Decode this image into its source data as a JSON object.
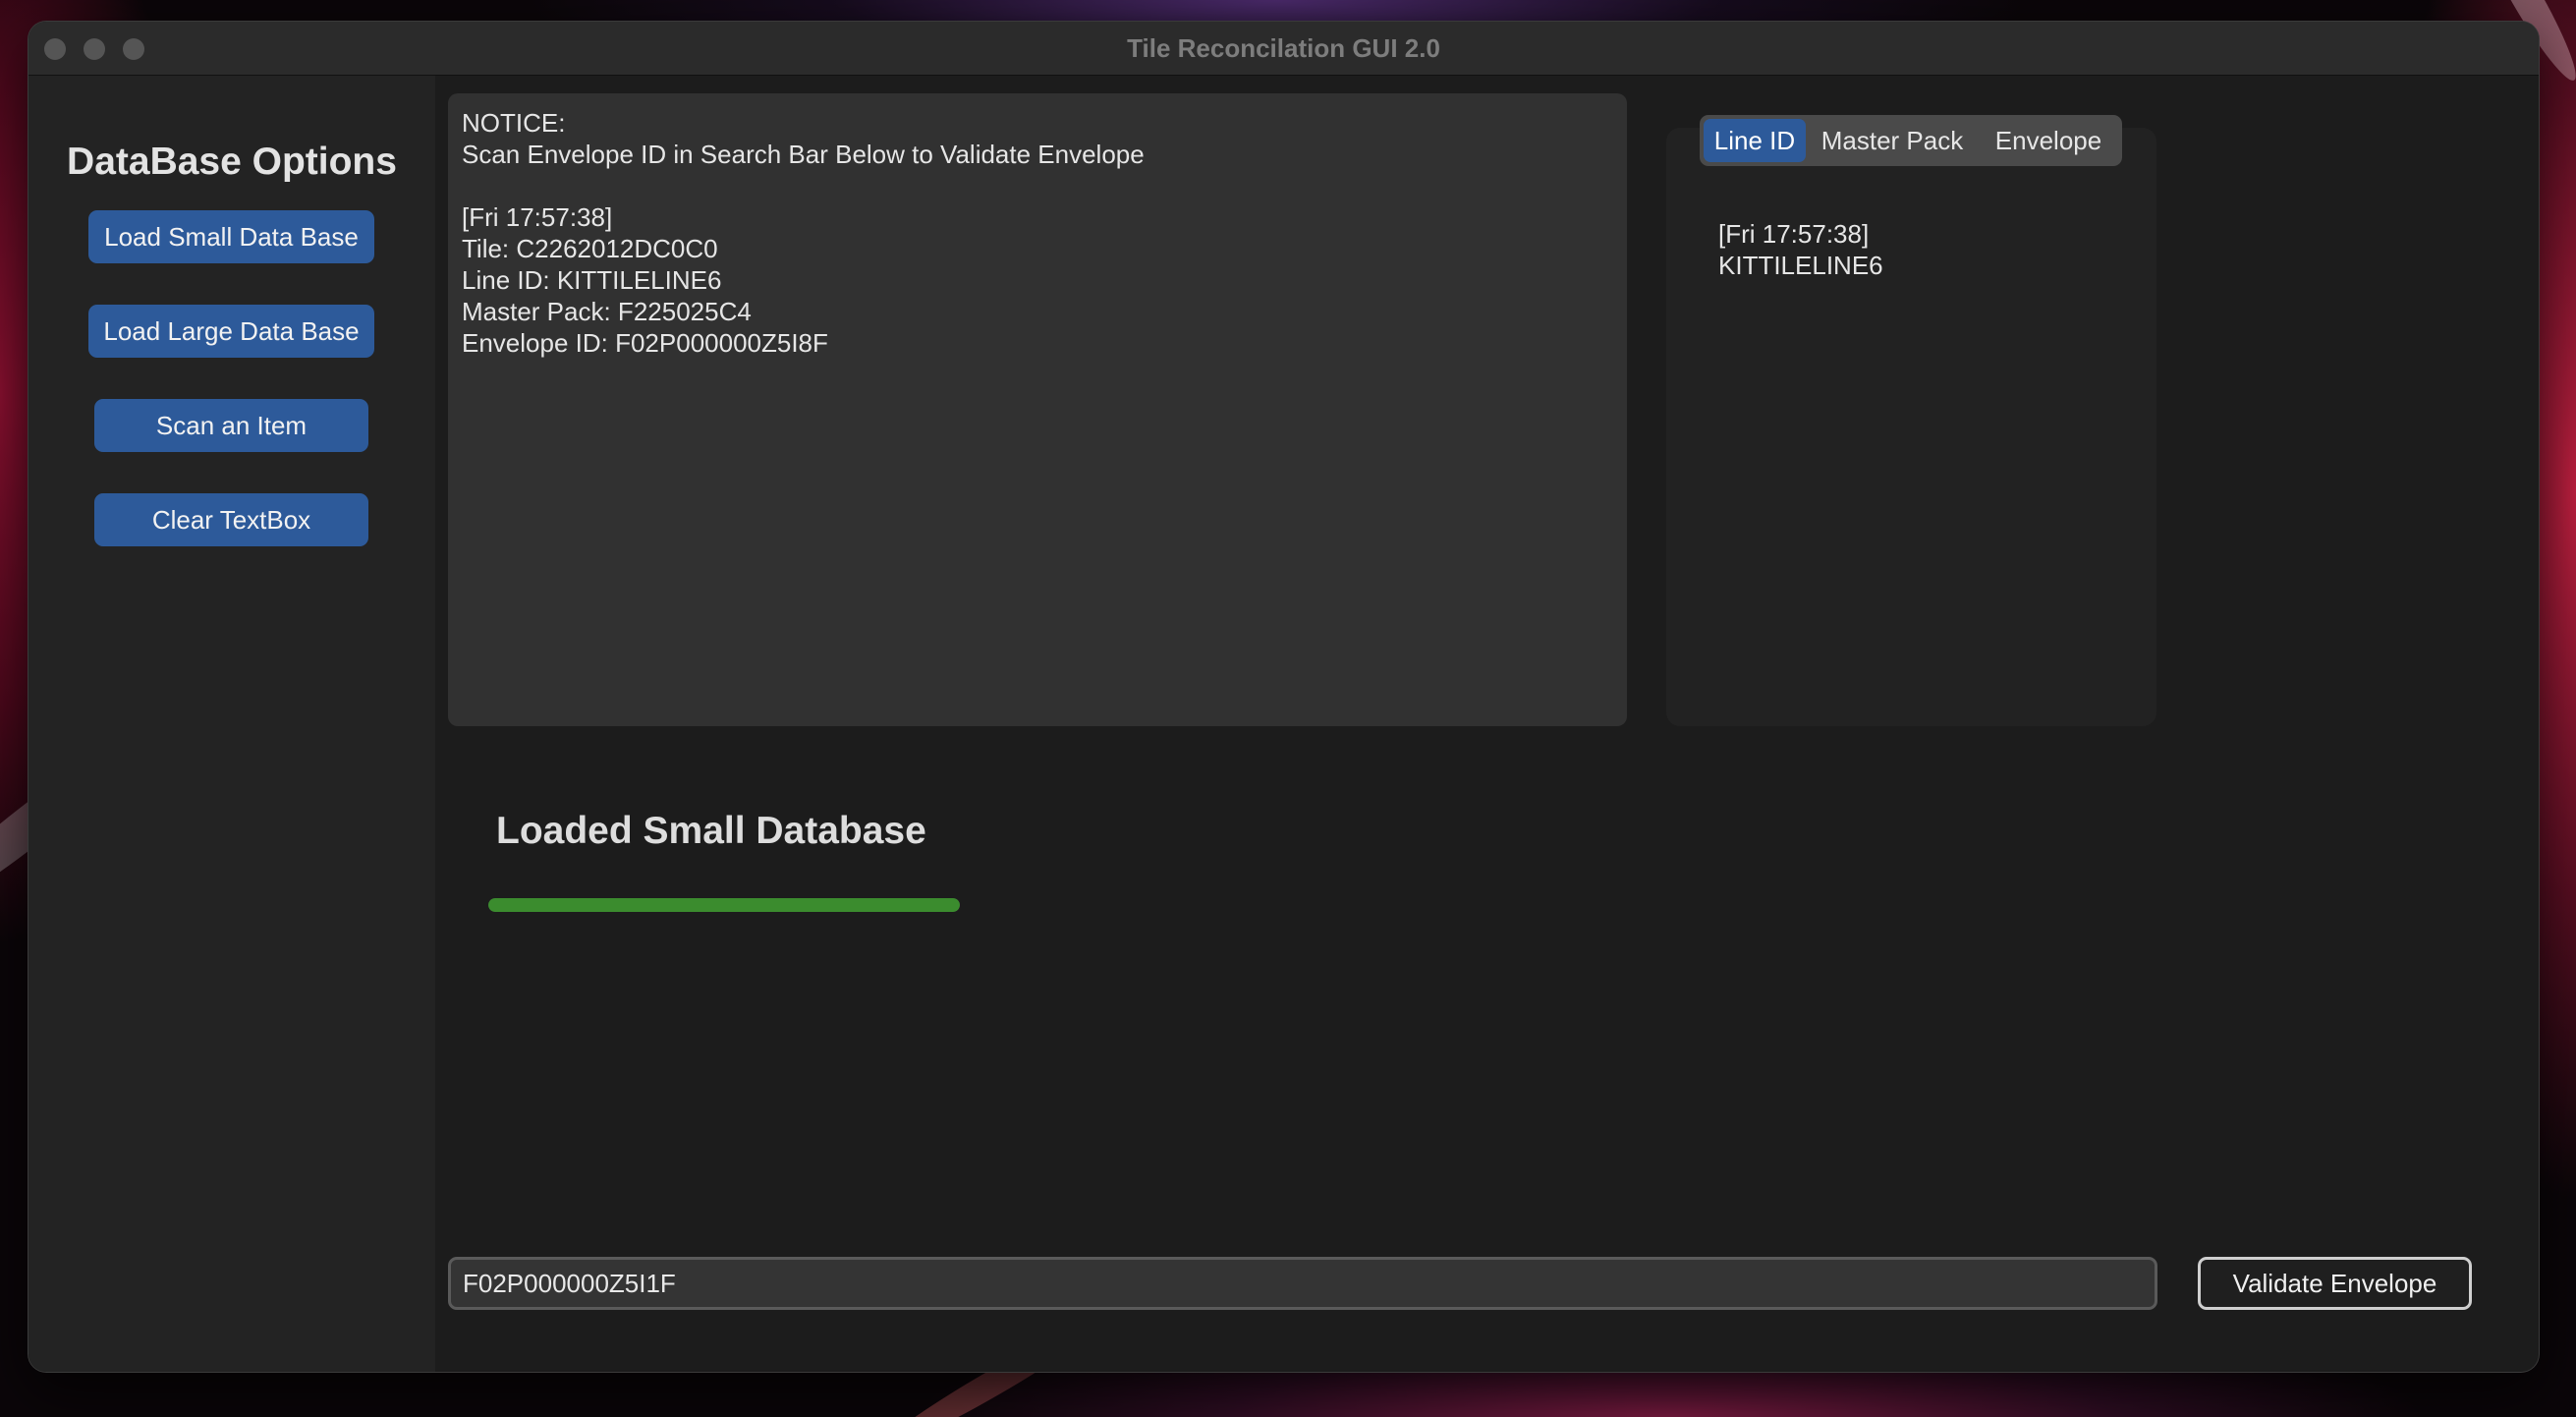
{
  "window": {
    "title": "Tile Reconcilation GUI 2.0"
  },
  "sidebar": {
    "title": "DataBase Options",
    "buttons": [
      {
        "label": "Load Small Data Base"
      },
      {
        "label": "Load Large Data Base"
      },
      {
        "label": "Scan an Item"
      },
      {
        "label": "Clear TextBox"
      }
    ]
  },
  "log": {
    "text": "NOTICE:\nScan Envelope ID in Search Bar Below to Validate Envelope\n\n[Fri 17:57:38]\nTile: C2262012DC0C0\nLine ID: KITTILELINE6\nMaster Pack: F225025C4\nEnvelope ID: F02P000000Z5I8F"
  },
  "tabs": {
    "items": [
      {
        "label": "Line ID"
      },
      {
        "label": "Master Pack"
      },
      {
        "label": "Envelope"
      }
    ],
    "selected": "Line ID",
    "content": "[Fri 17:57:38]\nKITTILELINE6"
  },
  "status": {
    "label": "Loaded Small Database",
    "progress": 1.0,
    "progress_color": "#3b8c2e"
  },
  "search": {
    "value": "F02P000000Z5I1F",
    "placeholder": ""
  },
  "validate": {
    "label": "Validate Envelope"
  },
  "colors": {
    "accent": "#2d5a9a",
    "window_bg": "#1c1c1c",
    "sidebar_bg": "#232323"
  }
}
